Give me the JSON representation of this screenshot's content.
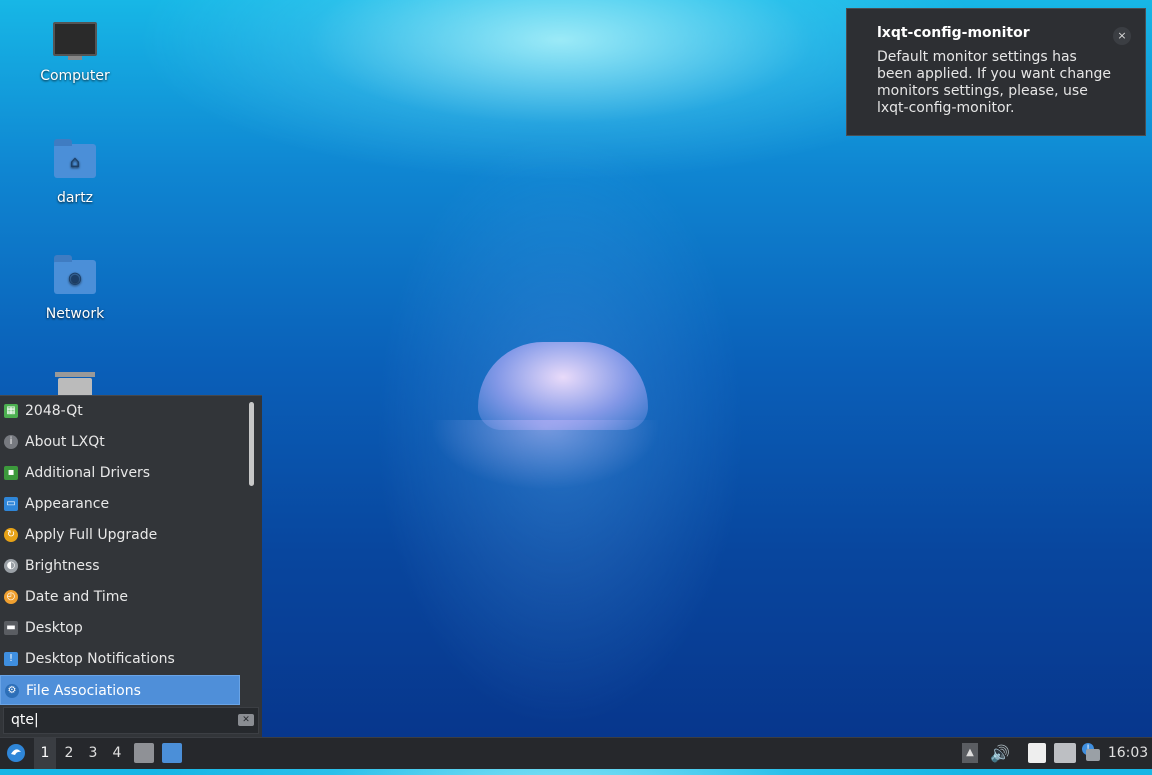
{
  "desktop": {
    "icons": [
      {
        "label": "Computer",
        "icon": "computer-icon"
      },
      {
        "label": "dartz",
        "icon": "home-folder-icon"
      },
      {
        "label": "Network",
        "icon": "network-folder-icon"
      },
      {
        "label": "",
        "icon": "trash-icon"
      }
    ]
  },
  "notification": {
    "title": "lxqt-config-monitor",
    "body": "Default monitor settings has been applied. If you want change monitors settings, please, use lxqt-config-monitor.",
    "close_glyph": "×"
  },
  "menu": {
    "items": [
      {
        "label": "2048-Qt",
        "icon": "game-2048-icon",
        "color": "#4caf50"
      },
      {
        "label": "About LXQt",
        "icon": "info-icon",
        "color": "#777a80"
      },
      {
        "label": "Additional Drivers",
        "icon": "chip-icon",
        "color": "#3c9a3c"
      },
      {
        "label": "Appearance",
        "icon": "appearance-icon",
        "color": "#2f86d8"
      },
      {
        "label": "Apply Full Upgrade",
        "icon": "upgrade-icon",
        "color": "#e8a317"
      },
      {
        "label": "Brightness",
        "icon": "brightness-icon",
        "color": "#9aa0a6"
      },
      {
        "label": "Date and Time",
        "icon": "clock-icon",
        "color": "#f0a030"
      },
      {
        "label": "Desktop",
        "icon": "desktop-icon",
        "color": "#5a5d62"
      },
      {
        "label": "Desktop Notifications",
        "icon": "notification-icon",
        "color": "#3f8fe0"
      },
      {
        "label": "File Associations",
        "icon": "file-associations-icon",
        "color": "#2d6fb8"
      }
    ],
    "selected_index": 9,
    "search_value": "qte"
  },
  "taskbar": {
    "desktops": [
      "1",
      "2",
      "3",
      "4"
    ],
    "current_desktop": "1",
    "clock": "16:03"
  }
}
